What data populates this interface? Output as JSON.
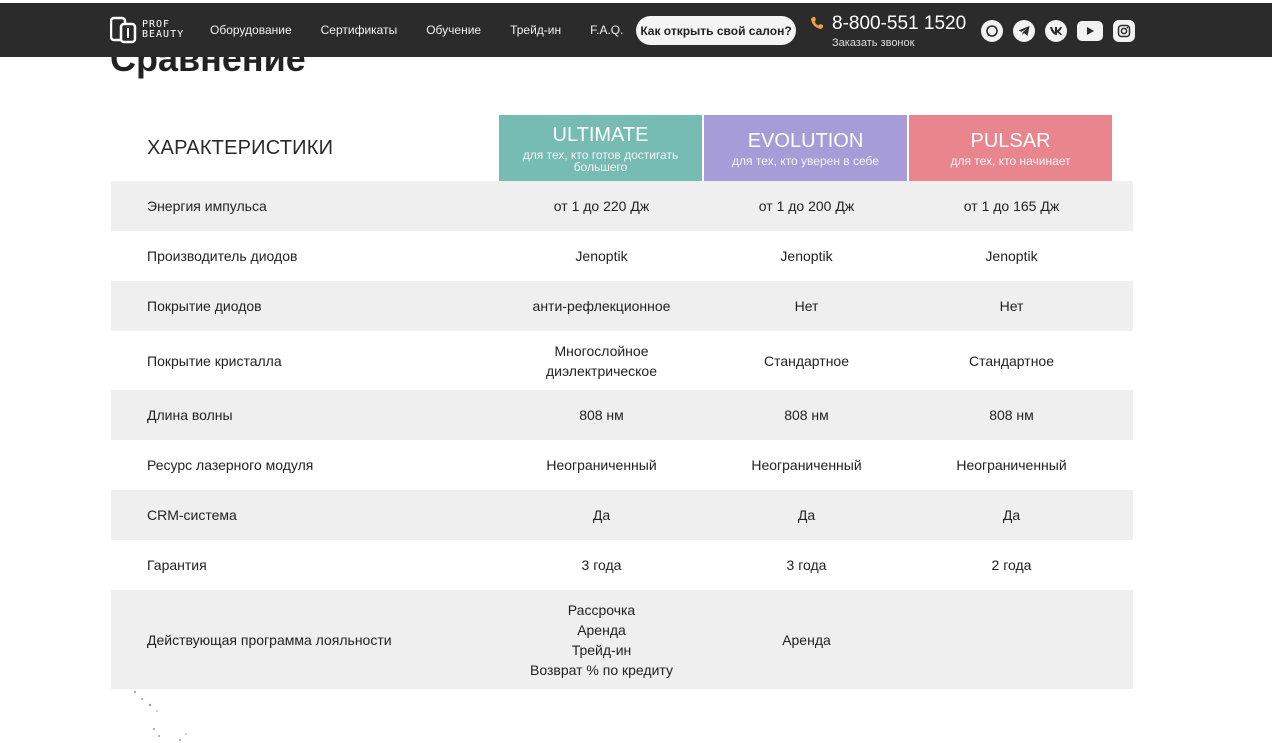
{
  "header": {
    "logo_text_1": "PROF",
    "logo_text_2": "BEAUTY",
    "nav": [
      "Оборудование",
      "Сертификаты",
      "Обучение",
      "Трейд-ин",
      "F.A.Q."
    ],
    "cta_label": "Как открыть свой салон?",
    "phone": "8-800-551 1520",
    "callback": "Заказать звонок",
    "socials": [
      "whatsapp-icon",
      "telegram-icon",
      "vk-icon",
      "youtube-icon",
      "instagram-icon"
    ]
  },
  "page": {
    "title": "Сравнение"
  },
  "compare": {
    "head_label": "ХАРАКТЕРИСТИКИ",
    "plans": [
      {
        "name": "ULTIMATE",
        "subtitle": "для тех, кто готов достигать большего",
        "color": "#76bcb2"
      },
      {
        "name": "EVOLUTION",
        "subtitle": "для тех, кто уверен в себе",
        "color": "#a59cd8"
      },
      {
        "name": "PULSAR",
        "subtitle": "для тех, кто начинает",
        "color": "#e8858d"
      }
    ],
    "rows": [
      {
        "label": "Энергия импульса",
        "values": [
          [
            "от 1 до 220 Дж"
          ],
          [
            "от 1 до 200 Дж"
          ],
          [
            "от 1 до 165 Дж"
          ]
        ]
      },
      {
        "label": "Производитель диодов",
        "values": [
          [
            "Jenoptik"
          ],
          [
            "Jenoptik"
          ],
          [
            "Jenoptik"
          ]
        ]
      },
      {
        "label": "Покрытие диодов",
        "values": [
          [
            "анти-рефлекционное"
          ],
          [
            "Нет"
          ],
          [
            "Нет"
          ]
        ]
      },
      {
        "label": "Покрытие кристалла",
        "values": [
          [
            "Многослойное",
            "диэлектрическое"
          ],
          [
            "Стандартное"
          ],
          [
            "Стандартное"
          ]
        ]
      },
      {
        "label": "Длина волны",
        "values": [
          [
            "808 нм"
          ],
          [
            "808 нм"
          ],
          [
            "808 нм"
          ]
        ]
      },
      {
        "label": "Ресурс лазерного модуля",
        "values": [
          [
            "Неограниченный"
          ],
          [
            "Неограниченный"
          ],
          [
            "Неограниченный"
          ]
        ]
      },
      {
        "label": "CRM-система",
        "values": [
          [
            "Да"
          ],
          [
            "Да"
          ],
          [
            "Да"
          ]
        ]
      },
      {
        "label": "Гарантия",
        "values": [
          [
            "3 года"
          ],
          [
            "3 года"
          ],
          [
            "2 года"
          ]
        ]
      },
      {
        "label": "Действующая программа лояльности",
        "values": [
          [
            "Рассрочка",
            "Аренда",
            "Трейд-ин",
            "Возврат % по кредиту"
          ],
          [
            "Аренда"
          ],
          []
        ]
      }
    ]
  }
}
